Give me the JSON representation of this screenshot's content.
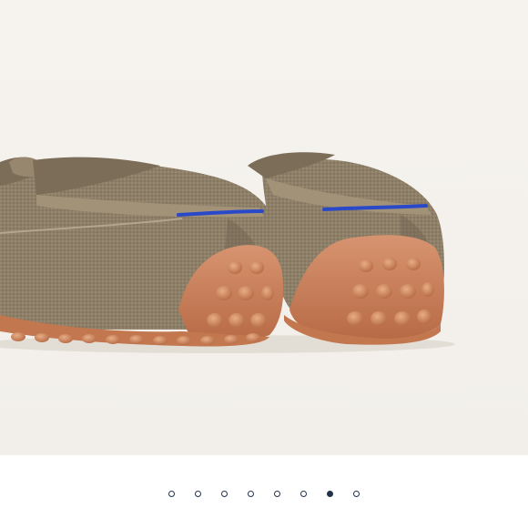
{
  "carousel": {
    "current_index": 7,
    "total": 8,
    "colors": {
      "dot": "#23324a",
      "background": "#ffffff"
    }
  },
  "product_image": {
    "colors": {
      "upper": "#8e7f68",
      "sole": "#c9805a",
      "accent_stitch": "#2a49c8"
    }
  }
}
